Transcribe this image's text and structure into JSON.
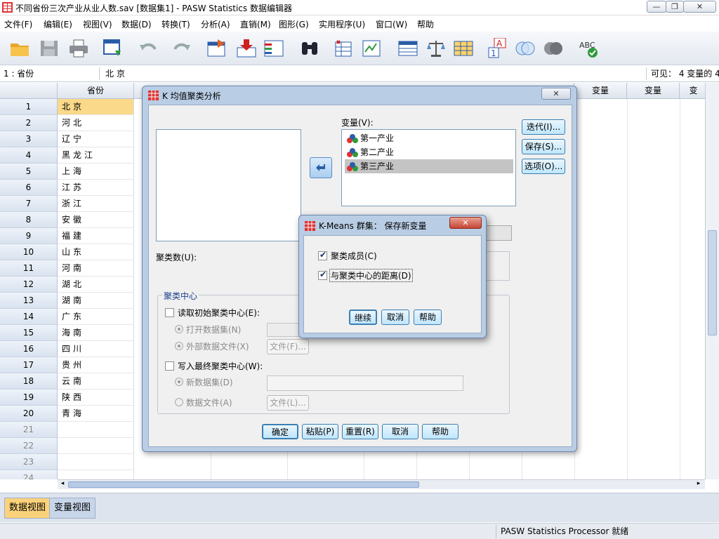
{
  "window": {
    "title": "不同省份三次产业从业人数.sav [数据集1] - PASW Statistics 数据编辑器",
    "minimize": "—",
    "restore": "❐",
    "close": "✕"
  },
  "menu": [
    "文件(F)",
    "编辑(E)",
    "视图(V)",
    "数据(D)",
    "转换(T)",
    "分析(A)",
    "直销(M)",
    "图形(G)",
    "实用程序(U)",
    "窗口(W)",
    "帮助"
  ],
  "cellbar": {
    "ref": "1 : 省份",
    "value": "北京",
    "visible": "可见： 4 变量的 4"
  },
  "grid": {
    "col_header": "省份",
    "var_headers": [
      "变量",
      "变量",
      "变"
    ],
    "rows": [
      {
        "n": "1",
        "v": "北京"
      },
      {
        "n": "2",
        "v": "河北"
      },
      {
        "n": "3",
        "v": "辽宁"
      },
      {
        "n": "4",
        "v": "黑龙江"
      },
      {
        "n": "5",
        "v": "上海"
      },
      {
        "n": "6",
        "v": "江苏"
      },
      {
        "n": "7",
        "v": "浙江"
      },
      {
        "n": "8",
        "v": "安徽"
      },
      {
        "n": "9",
        "v": "福建"
      },
      {
        "n": "10",
        "v": "山东"
      },
      {
        "n": "11",
        "v": "河南"
      },
      {
        "n": "12",
        "v": "湖北"
      },
      {
        "n": "13",
        "v": "湖南"
      },
      {
        "n": "14",
        "v": "广东"
      },
      {
        "n": "15",
        "v": "海南"
      },
      {
        "n": "16",
        "v": "四川"
      },
      {
        "n": "17",
        "v": "贵州"
      },
      {
        "n": "18",
        "v": "云南"
      },
      {
        "n": "19",
        "v": "陕西"
      },
      {
        "n": "20",
        "v": "青海"
      },
      {
        "n": "21",
        "v": ""
      },
      {
        "n": "22",
        "v": ""
      },
      {
        "n": "23",
        "v": ""
      },
      {
        "n": "24",
        "v": ""
      }
    ]
  },
  "tabs": {
    "data_view": "数据视图",
    "var_view": "变量视图"
  },
  "status": "PASW Statistics Processor 就绪",
  "kmeans_dialog": {
    "title": "K 均值聚类分析",
    "close": "✕",
    "variables_label": "变量(V):",
    "variables": [
      "第一产业",
      "第二产业",
      "第三产业"
    ],
    "selected_variable": "第三产业",
    "buttons_right": [
      "迭代(I)...",
      "保存(S)...",
      "选项(O)..."
    ],
    "num_clusters_label": "聚类数(U):",
    "centers_group": "聚类中心",
    "read_initial": "读取初始聚类中心(E):",
    "open_dataset": "打开数据集(N)",
    "external_file": "外部数据文件(X)",
    "file_btn_1": "文件(F)...",
    "write_final": "写入最终聚类中心(W):",
    "new_dataset": "新数据集(D)",
    "data_file": "数据文件(A)",
    "file_btn_2": "文件(L)...",
    "bottom_buttons": [
      "确定",
      "粘贴(P)",
      "重置(R)",
      "取消",
      "帮助"
    ]
  },
  "save_dialog": {
    "title": "K-Means 群集： 保存新变量",
    "close": "✕",
    "cluster_membership": "聚类成员(C)",
    "distance": "与聚类中心的距离(D)",
    "continue": "继续",
    "cancel": "取消",
    "help": "帮助"
  },
  "colors": {
    "selected_cell": "#fbd98a",
    "dialog_frame": "#b9cde5",
    "selected_var": "#c4c4c4"
  }
}
